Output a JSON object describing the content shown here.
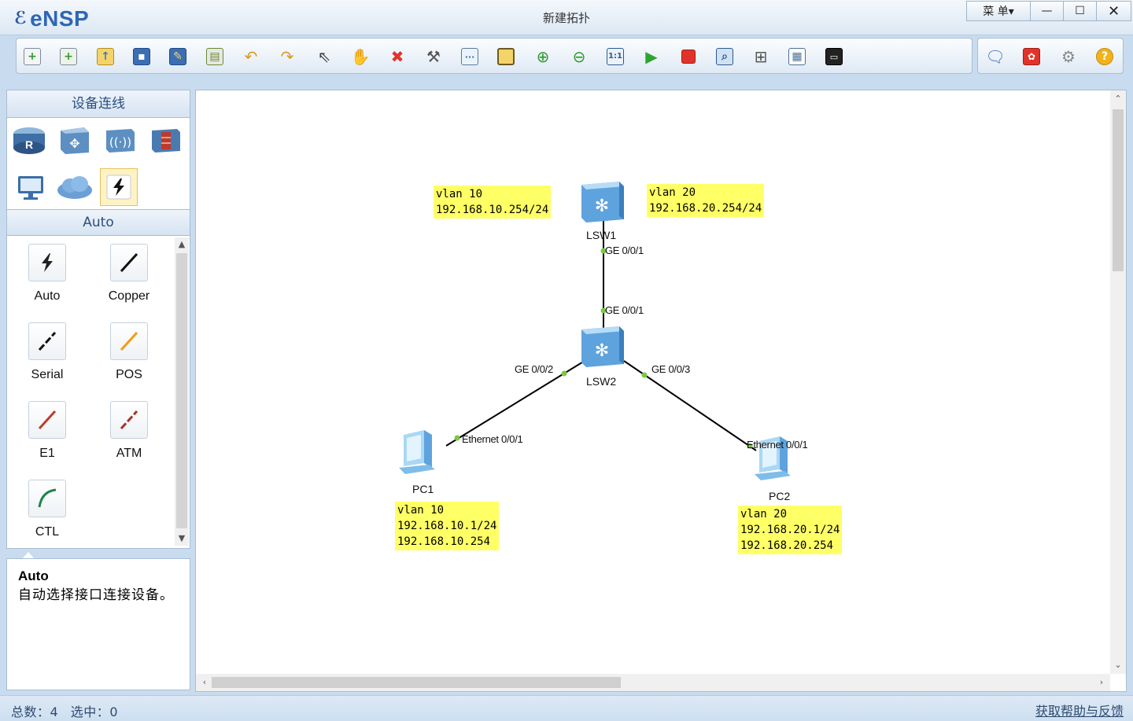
{
  "app": {
    "logo_text": "eNSP",
    "window_title": "新建拓扑"
  },
  "window_controls": {
    "menu_label": "菜 单▾",
    "minimize": "—",
    "maximize": "☐",
    "close": "✕"
  },
  "toolbar": {
    "items": [
      "new-topology",
      "new-from-template",
      "open",
      "save",
      "save-as",
      "print",
      "undo",
      "redo",
      "select",
      "pan",
      "delete",
      "delete-link",
      "text-note",
      "rectangle",
      "zoom-in",
      "zoom-out",
      "fit-view",
      "start-device",
      "stop-device",
      "capture",
      "topology-view",
      "table-view",
      "console"
    ],
    "right_items": [
      "feedback",
      "huawei",
      "settings",
      "help"
    ]
  },
  "left_panel": {
    "header": "设备连线",
    "devices": [
      "router",
      "switch",
      "wireless",
      "firewall",
      "pc",
      "cloud",
      "connection"
    ],
    "selected_category": "Auto",
    "cables": [
      {
        "label": "Auto",
        "icon": "auto-cable-icon",
        "color": "#222222"
      },
      {
        "label": "Copper",
        "icon": "copper-cable-icon",
        "color": "#111111"
      },
      {
        "label": "Serial",
        "icon": "serial-cable-icon",
        "color": "#111111"
      },
      {
        "label": "POS",
        "icon": "pos-cable-icon",
        "color": "#f39c12"
      },
      {
        "label": "E1",
        "icon": "e1-cable-icon",
        "color": "#c0392b"
      },
      {
        "label": "ATM",
        "icon": "atm-cable-icon",
        "color": "#a93226"
      },
      {
        "label": "CTL",
        "icon": "ctl-cable-icon",
        "color": "#1e8449"
      }
    ],
    "description": {
      "title": "Auto",
      "body": "自动选择接口连接设备。"
    }
  },
  "topology": {
    "devices": [
      {
        "id": "lsw1",
        "label": "LSW1",
        "type": "switch"
      },
      {
        "id": "lsw2",
        "label": "LSW2",
        "type": "switch"
      },
      {
        "id": "pc1",
        "label": "PC1",
        "type": "pc"
      },
      {
        "id": "pc2",
        "label": "PC2",
        "type": "pc"
      }
    ],
    "ports": {
      "lsw1_down": "GE 0/0/1",
      "lsw2_up": "GE 0/0/1",
      "lsw2_left": "GE 0/0/2",
      "lsw2_right": "GE 0/0/3",
      "pc1_port": "Ethernet 0/0/1",
      "pc2_port": "Ethernet 0/0/1"
    },
    "notes": {
      "vlan10_gw": "vlan 10\n192.168.10.254/24",
      "vlan20_gw": "vlan 20\n192.168.20.254/24",
      "pc1_cfg": "vlan 10\n192.168.10.1/24\n192.168.10.254",
      "pc2_cfg": "vlan 20\n192.168.20.1/24\n192.168.20.254"
    },
    "link_color": "#000000",
    "port_dot_color": "#7ac943",
    "note_color": "#ffff66"
  },
  "status": {
    "total_label": "总数：",
    "total": "4",
    "selected_label": "选中：",
    "selected": "0",
    "feedback_link": "获取帮助与反馈"
  }
}
